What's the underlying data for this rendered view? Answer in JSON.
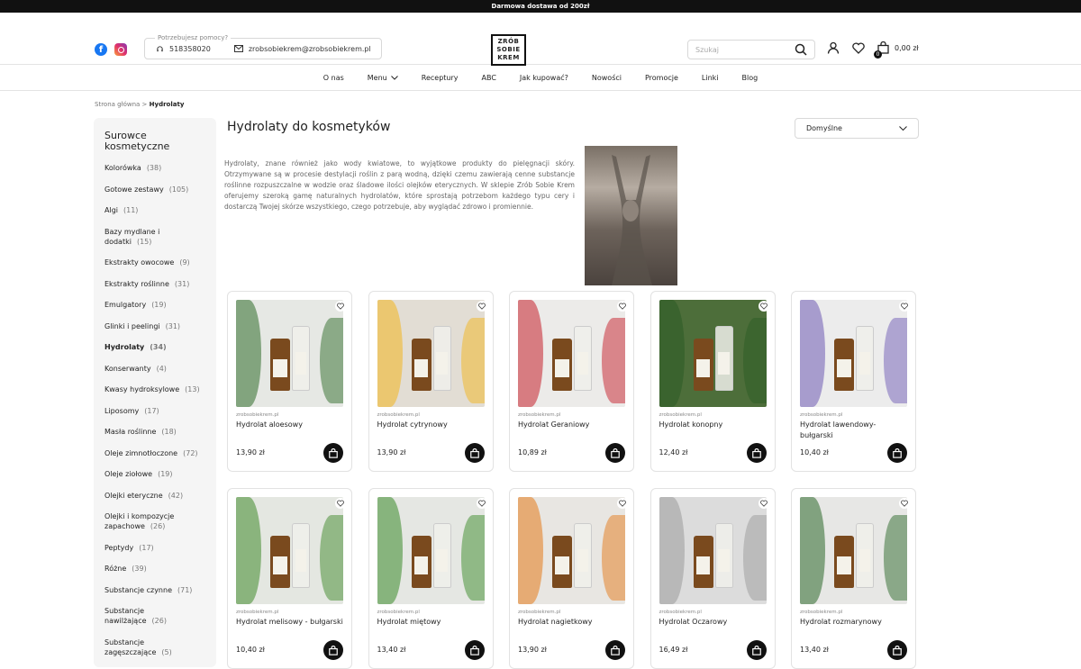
{
  "topbar": {
    "text": "Darmowa dostawa od 200zł"
  },
  "header": {
    "help_label": "Potrzebujesz pomocy?",
    "phone": "518358020",
    "email": "zrobsobiekrem@zrobsobiekrem.pl",
    "logo_lines": [
      "ZRÓB",
      "SOBIE",
      "KREM"
    ],
    "search_placeholder": "Szukaj",
    "cart_total": "0,00 zł",
    "cart_count": "0"
  },
  "nav": {
    "items": [
      "O nas",
      "Menu",
      "Receptury",
      "ABC",
      "Jak kupować?",
      "Nowości",
      "Promocje",
      "Linki",
      "Blog"
    ]
  },
  "breadcrumb": {
    "home": "Strona główna",
    "separator": ">",
    "current": "Hydrolaty"
  },
  "sidebar": {
    "title": "Surowce kosmetyczne",
    "items": [
      {
        "label": "Kolorówka",
        "count": "(38)"
      },
      {
        "label": "Gotowe zestawy",
        "count": "(105)"
      },
      {
        "label": "Algi",
        "count": "(11)"
      },
      {
        "label": "Bazy mydlane i dodatki",
        "count": "(15)"
      },
      {
        "label": "Ekstrakty owocowe",
        "count": "(9)"
      },
      {
        "label": "Ekstrakty roślinne",
        "count": "(31)"
      },
      {
        "label": "Emulgatory",
        "count": "(19)"
      },
      {
        "label": "Glinki i peelingi",
        "count": "(31)"
      },
      {
        "label": "Hydrolaty",
        "count": "(34)"
      },
      {
        "label": "Konserwanty",
        "count": "(4)"
      },
      {
        "label": "Kwasy hydroksylowe",
        "count": "(13)"
      },
      {
        "label": "Liposomy",
        "count": "(17)"
      },
      {
        "label": "Masła roślinne",
        "count": "(18)"
      },
      {
        "label": "Oleje zimnotłoczone",
        "count": "(72)"
      },
      {
        "label": "Oleje ziołowe",
        "count": "(19)"
      },
      {
        "label": "Olejki eteryczne",
        "count": "(42)"
      },
      {
        "label": "Olejki i kompozycje zapachowe",
        "count": "(26)"
      },
      {
        "label": "Peptydy",
        "count": "(17)"
      },
      {
        "label": "Różne",
        "count": "(39)"
      },
      {
        "label": "Substancje czynne",
        "count": "(71)"
      },
      {
        "label": "Substancje nawilżające",
        "count": "(26)"
      },
      {
        "label": "Substancje zagęszczające",
        "count": "(5)"
      }
    ]
  },
  "main": {
    "title": "Hydrolaty do kosmetyków",
    "sort_value": "Domyślne",
    "description": "Hydrolaty, znane również jako wody kwiatowe, to wyjątkowe produkty do pielęgnacji skóry. Otrzymywane są w procesie destylacji roślin z parą wodną, dzięki czemu zawierają cenne substancje roślinne rozpuszczalne w wodzie oraz śladowe ilości olejków eterycznych. W sklepie Zrób Sobie Krem oferujemy szeroką gamę naturalnych hydrolatów, które sprostają potrzebom każdego typu cery i dostarczą Twojej skórze wszystkiego, czego potrzebuje, aby wyglądać zdrowo i promiennie."
  },
  "products": [
    {
      "brand": "zrobsobiekrem.pl",
      "name": "Hydrolat aloesowy",
      "price": "13,90 zł",
      "bg": "#e6e8e4",
      "accent": "#2f6b2a"
    },
    {
      "brand": "zrobsobiekrem.pl",
      "name": "Hydrolat cytrynowy",
      "price": "13,90 zł",
      "bg": "#e2ddd4",
      "accent": "#f2b51e"
    },
    {
      "brand": "zrobsobiekrem.pl",
      "name": "Hydrolat Geraniowy",
      "price": "10,89 zł",
      "bg": "#ecebe9",
      "accent": "#c6202b"
    },
    {
      "brand": "zrobsobiekrem.pl",
      "name": "Hydrolat konopny",
      "price": "12,40 zł",
      "bg": "#4d6e3a",
      "accent": "#2c5b24"
    },
    {
      "brand": "zrobsobiekrem.pl",
      "name": "Hydrolat lawendowy- bułgarski",
      "price": "10,40 zł",
      "bg": "#ececec",
      "accent": "#6f5bb5"
    },
    {
      "brand": "zrobsobiekrem.pl",
      "name": "Hydrolat melisowy - bułgarski",
      "price": "10,40 zł",
      "bg": "#e4e7e1",
      "accent": "#3f8a2c"
    },
    {
      "brand": "zrobsobiekrem.pl",
      "name": "Hydrolat miętowy",
      "price": "13,40 zł",
      "bg": "#e5e7e3",
      "accent": "#3b8b2a"
    },
    {
      "brand": "zrobsobiekrem.pl",
      "name": "Hydrolat nagietkowy",
      "price": "13,90 zł",
      "bg": "#e8e6e2",
      "accent": "#e47a1a"
    },
    {
      "brand": "zrobsobiekrem.pl",
      "name": "Hydrolat Oczarowy",
      "price": "16,49 zł",
      "bg": "#dcdcdc",
      "accent": "#9a9a9a"
    },
    {
      "brand": "zrobsobiekrem.pl",
      "name": "Hydrolat rozmarynowy",
      "price": "13,40 zł",
      "bg": "#e7e7e5",
      "accent": "#2e6a2b"
    }
  ]
}
